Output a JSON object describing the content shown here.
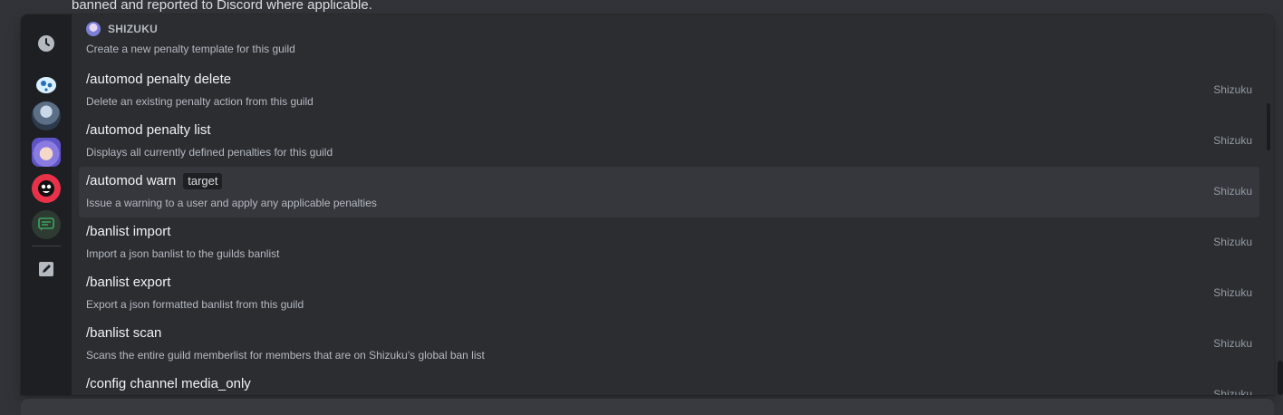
{
  "background": {
    "message_text": "banned and reported to Discord where applicable."
  },
  "rail": {
    "items": [
      {
        "name": "recent-clock-icon"
      },
      {
        "name": "app-icon-1"
      },
      {
        "name": "app-icon-2"
      },
      {
        "name": "app-icon-3"
      },
      {
        "name": "app-icon-4"
      },
      {
        "name": "app-icon-5"
      },
      {
        "name": "edit-icon"
      }
    ]
  },
  "section": {
    "title": "SHIZUKU",
    "first_desc": "Create a new penalty template for this guild"
  },
  "commands": [
    {
      "name": "/automod penalty delete",
      "desc": "Delete an existing penalty action from this guild",
      "source": "Shizuku"
    },
    {
      "name": "/automod penalty list",
      "desc": "Displays all currently defined penalties for this guild",
      "source": "Shizuku"
    },
    {
      "name": "/automod warn",
      "option": "target",
      "desc": "Issue a warning to a user and apply any applicable penalties",
      "source": "Shizuku",
      "selected": true
    },
    {
      "name": "/banlist import",
      "desc": "Import a json banlist to the guilds banlist",
      "source": "Shizuku"
    },
    {
      "name": "/banlist export",
      "desc": "Export a json formatted banlist from this guild",
      "source": "Shizuku"
    },
    {
      "name": "/banlist scan",
      "desc": "Scans the entire guild memberlist for members that are on Shizuku's global ban list",
      "source": "Shizuku"
    },
    {
      "name": "/config channel media_only",
      "desc": "",
      "source": "Shizuku"
    }
  ],
  "colors": {
    "popup_bg": "#2b2d31",
    "rail_bg": "#1e1f22",
    "selected_bg": "#35373c",
    "text_primary": "#f2f3f5",
    "text_muted": "#b5bac1"
  }
}
